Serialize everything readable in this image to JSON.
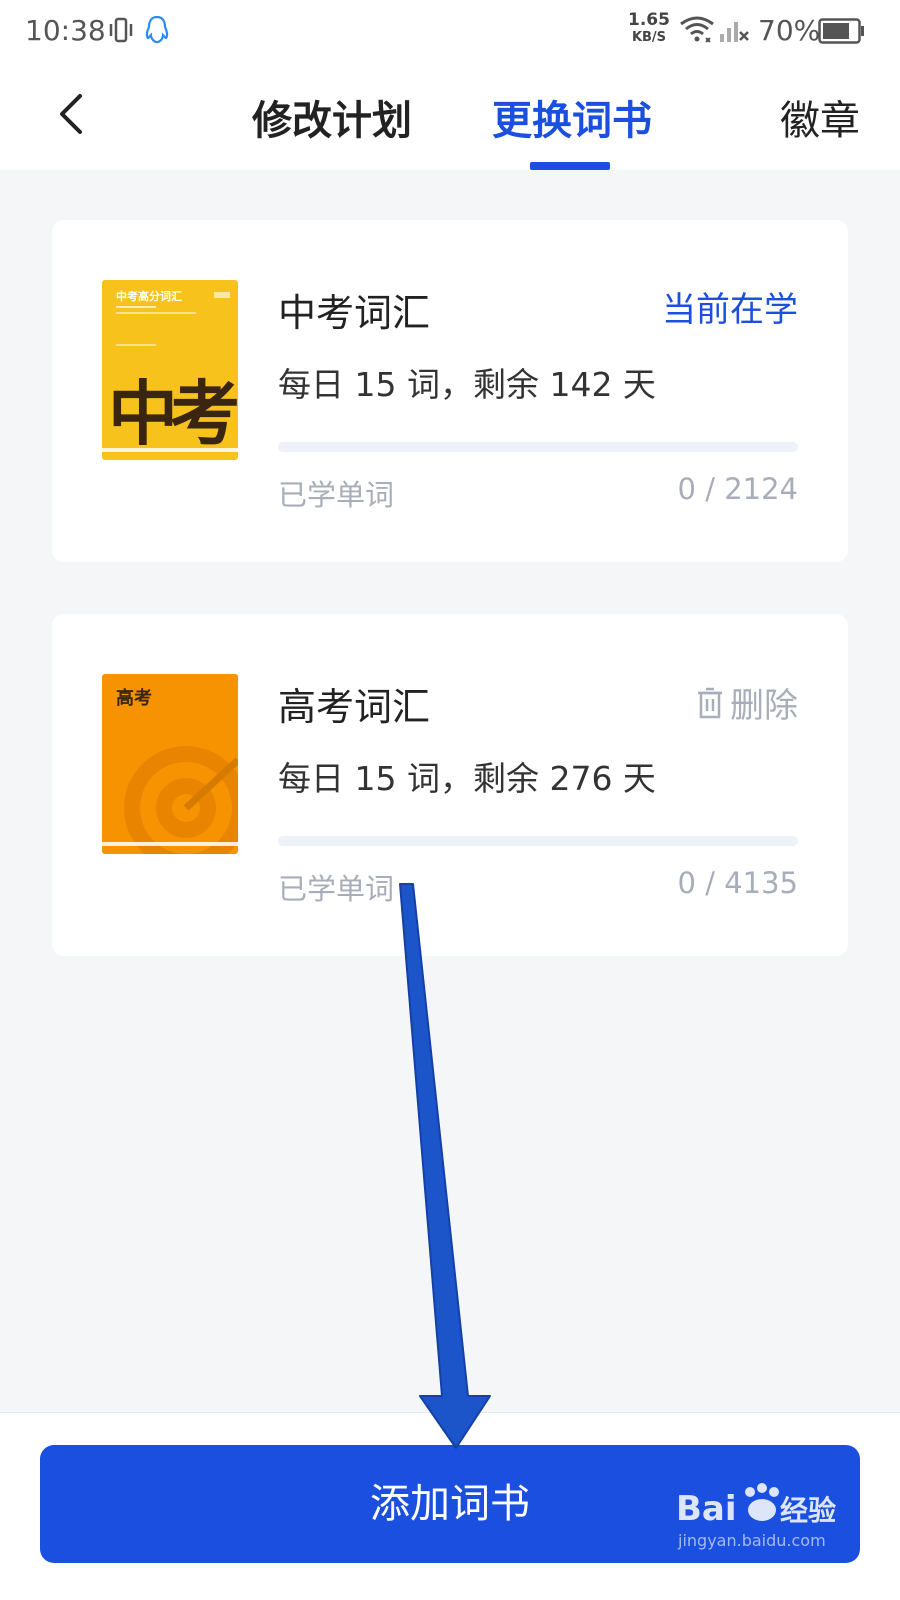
{
  "status_bar": {
    "time": "10:38",
    "net_speed_value": "1.65",
    "net_speed_unit": "KB/S",
    "battery": "70%"
  },
  "header": {
    "tabs": [
      {
        "label": "修改计划",
        "active": false
      },
      {
        "label": "更换词书",
        "active": true
      },
      {
        "label": "徽章",
        "active": false
      }
    ]
  },
  "books": [
    {
      "title": "中考词汇",
      "plan": "每日 15 词，剩余 142 天",
      "status": "当前在学",
      "learned_label": "已学单词",
      "learned_count": "0 / 2124",
      "progress_fraction": 0,
      "cover": {
        "heading": "中考高分词汇",
        "big_text": "中考",
        "color": "#f7c21c"
      }
    },
    {
      "title": "高考词汇",
      "plan": "每日 15 词，剩余 276 天",
      "action": "删除",
      "learned_label": "已学单词",
      "learned_count": "0 / 4135",
      "progress_fraction": 0,
      "cover": {
        "heading": "高考",
        "color": "#f79300"
      }
    }
  ],
  "add_button": "添加词书",
  "colors": {
    "accent": "#1a4fdf",
    "muted": "#a8aeb9"
  }
}
